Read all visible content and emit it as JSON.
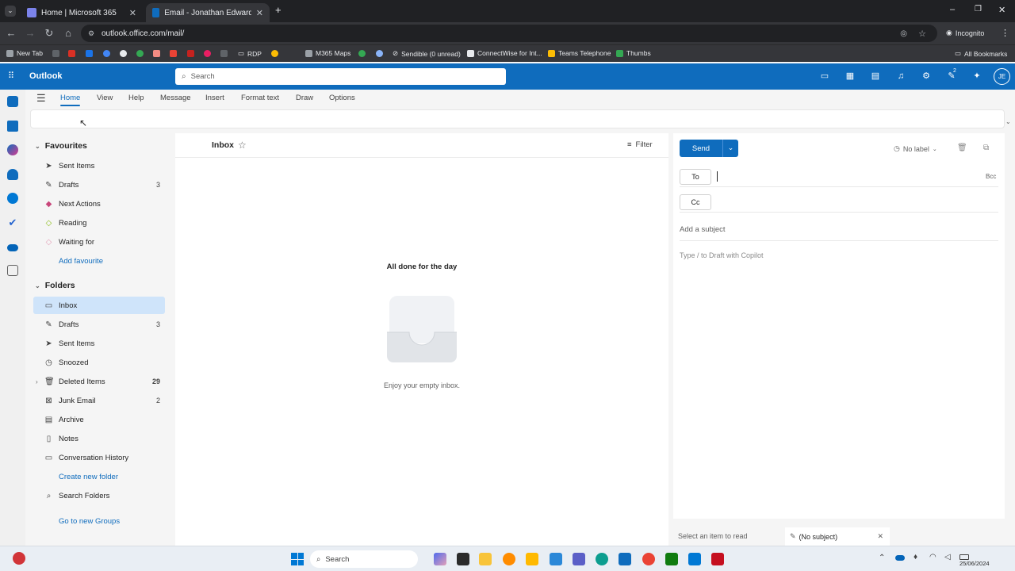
{
  "browser": {
    "tabs": [
      {
        "title": "Home | Microsoft 365",
        "active": false
      },
      {
        "title": "Email - Jonathan Edwards - Out",
        "active": true
      }
    ],
    "new_tab": "+",
    "url": "outlook.office.com/mail/",
    "profile": "Incognito",
    "bookmarks": [
      "New Tab",
      "RDP",
      "M365 Maps",
      "Sendible (0 unread)",
      "ConnectWise for Int...",
      "Teams Telephone",
      "Thumbs"
    ],
    "all_bookmarks": "All Bookmarks"
  },
  "outlook": {
    "app_name": "Outlook",
    "search_placeholder": "Search",
    "notification_badge": "2",
    "avatar_initials": "JE",
    "brand_color": "#0f6cbd",
    "ribbon_tabs": [
      "Home",
      "View",
      "Help",
      "Message",
      "Insert",
      "Format text",
      "Draw",
      "Options"
    ],
    "folder_pane": {
      "favourites_title": "Favourites",
      "favourites": [
        {
          "label": "Sent Items",
          "count": ""
        },
        {
          "label": "Drafts",
          "count": "3"
        },
        {
          "label": "Next Actions",
          "count": ""
        },
        {
          "label": "Reading",
          "count": ""
        },
        {
          "label": "Waiting for",
          "count": ""
        }
      ],
      "add_favourite": "Add favourite",
      "folders_title": "Folders",
      "folders": [
        {
          "label": "Inbox",
          "count": ""
        },
        {
          "label": "Drafts",
          "count": "3"
        },
        {
          "label": "Sent Items",
          "count": ""
        },
        {
          "label": "Snoozed",
          "count": ""
        },
        {
          "label": "Deleted Items",
          "count": "29"
        },
        {
          "label": "Junk Email",
          "count": "2"
        },
        {
          "label": "Archive",
          "count": ""
        },
        {
          "label": "Notes",
          "count": ""
        },
        {
          "label": "Conversation History",
          "count": ""
        }
      ],
      "create_new_folder": "Create new folder",
      "search_folders": "Search Folders",
      "go_to_groups": "Go to new Groups"
    },
    "message_list": {
      "title": "Inbox",
      "filter": "Filter",
      "empty_title": "All done for the day",
      "empty_subtitle": "Enjoy your empty inbox."
    },
    "compose": {
      "send": "Send",
      "label": "No label",
      "to": "To",
      "bcc": "Bcc",
      "cc": "Cc",
      "subject_placeholder": "Add a subject",
      "body_placeholder": "Type / to Draft with Copilot"
    },
    "status": {
      "reading": "Select an item to read",
      "draft_tab": "(No subject)"
    }
  },
  "taskbar": {
    "search": "Search",
    "date": "25/06/2024"
  }
}
